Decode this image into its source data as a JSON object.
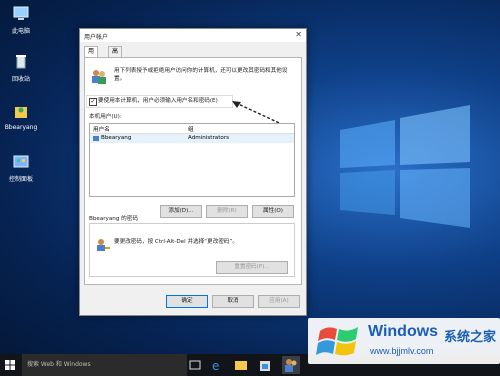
{
  "desktop": {
    "icons": [
      {
        "label": "此电脑"
      },
      {
        "label": "回收站"
      },
      {
        "label": "Bbearyang"
      },
      {
        "label": "控制面板"
      }
    ]
  },
  "dialog": {
    "title": "用户帐户",
    "tabs": [
      {
        "label": "用户"
      },
      {
        "label": "高级"
      }
    ],
    "description": "用下列表授予或拒绝用户访问你的计算机，还可以更改其密码和其他设置。",
    "checkbox_label": "要使用本计算机，用户必须输入用户名和密码(E)",
    "checkbox_checked": "✓",
    "users_section_label": "本机用户(U):",
    "columns": [
      "用户名",
      "组"
    ],
    "rows": [
      {
        "user": "Bbearyang",
        "group": "Administrators"
      }
    ],
    "buttons": {
      "add": "添加(D)...",
      "remove": "删除(R)",
      "properties": "属性(O)"
    },
    "password_group_title": "Bbearyang 的密码",
    "password_hint": "要更改密码，按 Ctrl-Alt-Del 并选择“更改密码”。",
    "reset_password": "重置密码(P)...",
    "ok": "确定",
    "cancel": "取消",
    "apply": "应用(A)"
  },
  "taskbar": {
    "search_placeholder": "搜索 Web 和 Windows"
  },
  "watermark": {
    "title": "Windows",
    "cn": "系统之家",
    "url": "www.bjjmlv.com"
  }
}
